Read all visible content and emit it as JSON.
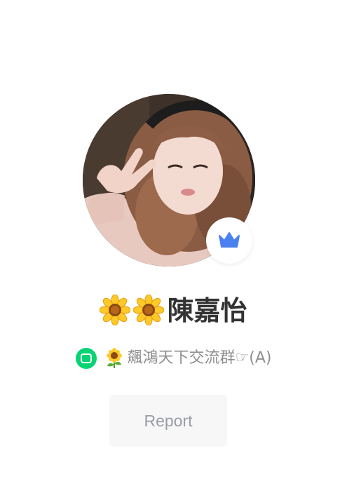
{
  "profile": {
    "display_name": "陳嘉怡",
    "name_prefix_icons": [
      "sunflower-icon",
      "sunflower-icon"
    ],
    "badge_icon": "crown-icon",
    "badge_color": "#4a80f0"
  },
  "group": {
    "icon": "openchat-icon",
    "icon_color": "#08d374",
    "prefix_icon": "sunflower-icon",
    "name": "飆鴻天下交流群☞(A)"
  },
  "actions": {
    "report_label": "Report"
  }
}
